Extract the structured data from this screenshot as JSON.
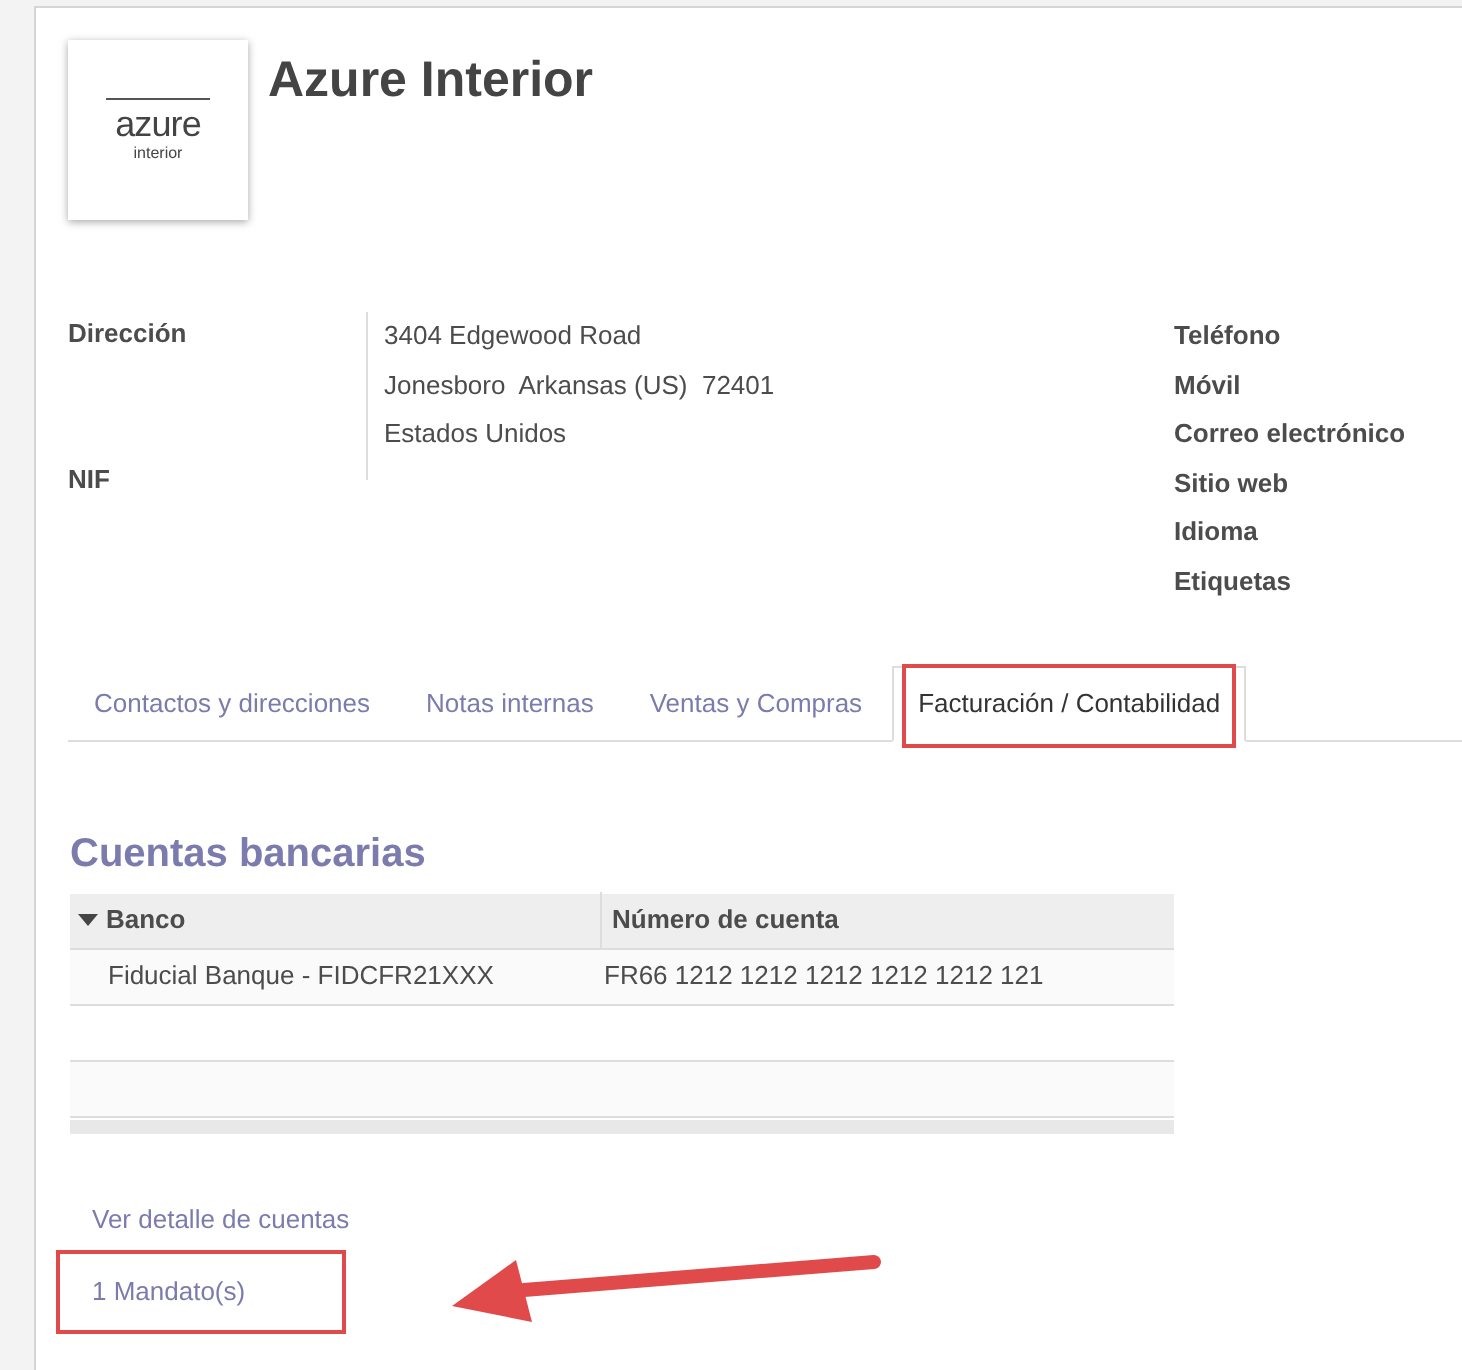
{
  "logo": {
    "name": "azure",
    "subtitle": "interior"
  },
  "title": "Azure Interior",
  "address": {
    "label": "Dirección",
    "lines": [
      "3404 Edgewood Road",
      "Jonesboro  Arkansas (US)  72401",
      "Estados Unidos"
    ]
  },
  "tax_id": {
    "label": "NIF"
  },
  "contact_labels": [
    "Teléfono",
    "Móvil",
    "Correo electrónico",
    "Sitio web",
    "Idioma",
    "Etiquetas"
  ],
  "tabs": [
    {
      "label": "Contactos y direcciones",
      "selected": false,
      "highlighted": false
    },
    {
      "label": "Notas internas",
      "selected": false,
      "highlighted": false
    },
    {
      "label": "Ventas y Compras",
      "selected": false,
      "highlighted": false
    },
    {
      "label": "Facturación / Contabilidad",
      "selected": true,
      "highlighted": true
    }
  ],
  "bank_accounts": {
    "heading": "Cuentas bancarias",
    "columns": [
      "Banco",
      "Número de cuenta"
    ],
    "rows": [
      [
        "Fiducial Banque - FIDCFR21XXX",
        "FR66 1212 1212 1212 1212 1212 121"
      ]
    ]
  },
  "links": [
    {
      "label": "Ver detalle de cuentas",
      "highlighted": false
    },
    {
      "label": "1 Mandato(s)",
      "highlighted": true
    }
  ]
}
